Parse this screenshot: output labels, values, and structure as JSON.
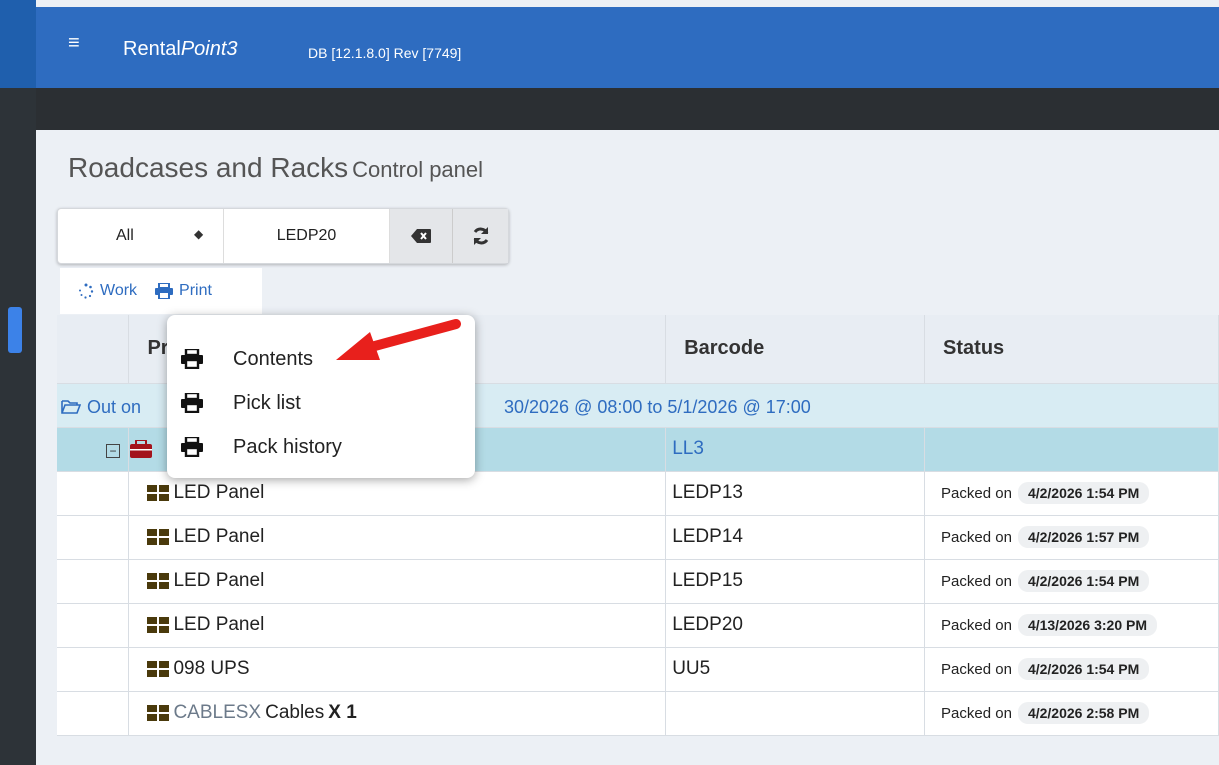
{
  "app": {
    "brand_prefix": "Rental",
    "brand_suffix": "Point3",
    "version": "DB [12.1.8.0]  Rev [7749]"
  },
  "page": {
    "title": "Roadcases and Racks",
    "subtitle": "Control panel"
  },
  "filter": {
    "select_value": "All",
    "search_value": "LEDP20"
  },
  "actions": {
    "work_label": "Work",
    "print_label": "Print"
  },
  "print_menu": {
    "items": [
      {
        "label": "Contents"
      },
      {
        "label": "Pick list"
      },
      {
        "label": "Pack history"
      }
    ]
  },
  "table": {
    "headers": {
      "product": "Pr",
      "barcode": "Barcode",
      "status": "Status"
    },
    "group": {
      "prefix": "Out on",
      "dates": "30/2026 @ 08:00  to  5/1/2026 @ 17:00"
    },
    "rack": {
      "barcode": "LL3"
    },
    "rows": [
      {
        "product": "LED Panel",
        "barcode": "LEDP13",
        "status_label": "Packed on",
        "status_date": "4/2/2026 1:54 PM"
      },
      {
        "product": "LED Panel",
        "barcode": "LEDP14",
        "status_label": "Packed on",
        "status_date": "4/2/2026 1:57 PM"
      },
      {
        "product": "LED Panel",
        "barcode": "LEDP15",
        "status_label": "Packed on",
        "status_date": "4/2/2026 1:54 PM"
      },
      {
        "product": "LED Panel",
        "barcode": "LEDP20",
        "status_label": "Packed on",
        "status_date": "4/13/2026 3:20 PM"
      },
      {
        "product": "098 UPS",
        "barcode": "UU5",
        "status_label": "Packed on",
        "status_date": "4/2/2026 1:54 PM"
      }
    ],
    "last_row": {
      "code": "CABLESX",
      "name": "Cables",
      "qty": "X 1",
      "barcode": "",
      "status_label": "Packed on",
      "status_date": "4/2/2026 2:58 PM"
    }
  },
  "colors": {
    "topbar": "#2e6cc0",
    "accent": "#2e6cc0",
    "arrow": "#e8201c",
    "item_icon": "#4a3a0c",
    "rack_icon": "#a3131c"
  },
  "icons": {
    "menu": "hamburger-icon",
    "clear": "backspace-icon",
    "refresh": "refresh-icon",
    "work": "spinner-icon",
    "print": "printer-icon",
    "folder": "folder-open-icon",
    "item": "grid-icon",
    "rack": "toolbox-icon"
  }
}
